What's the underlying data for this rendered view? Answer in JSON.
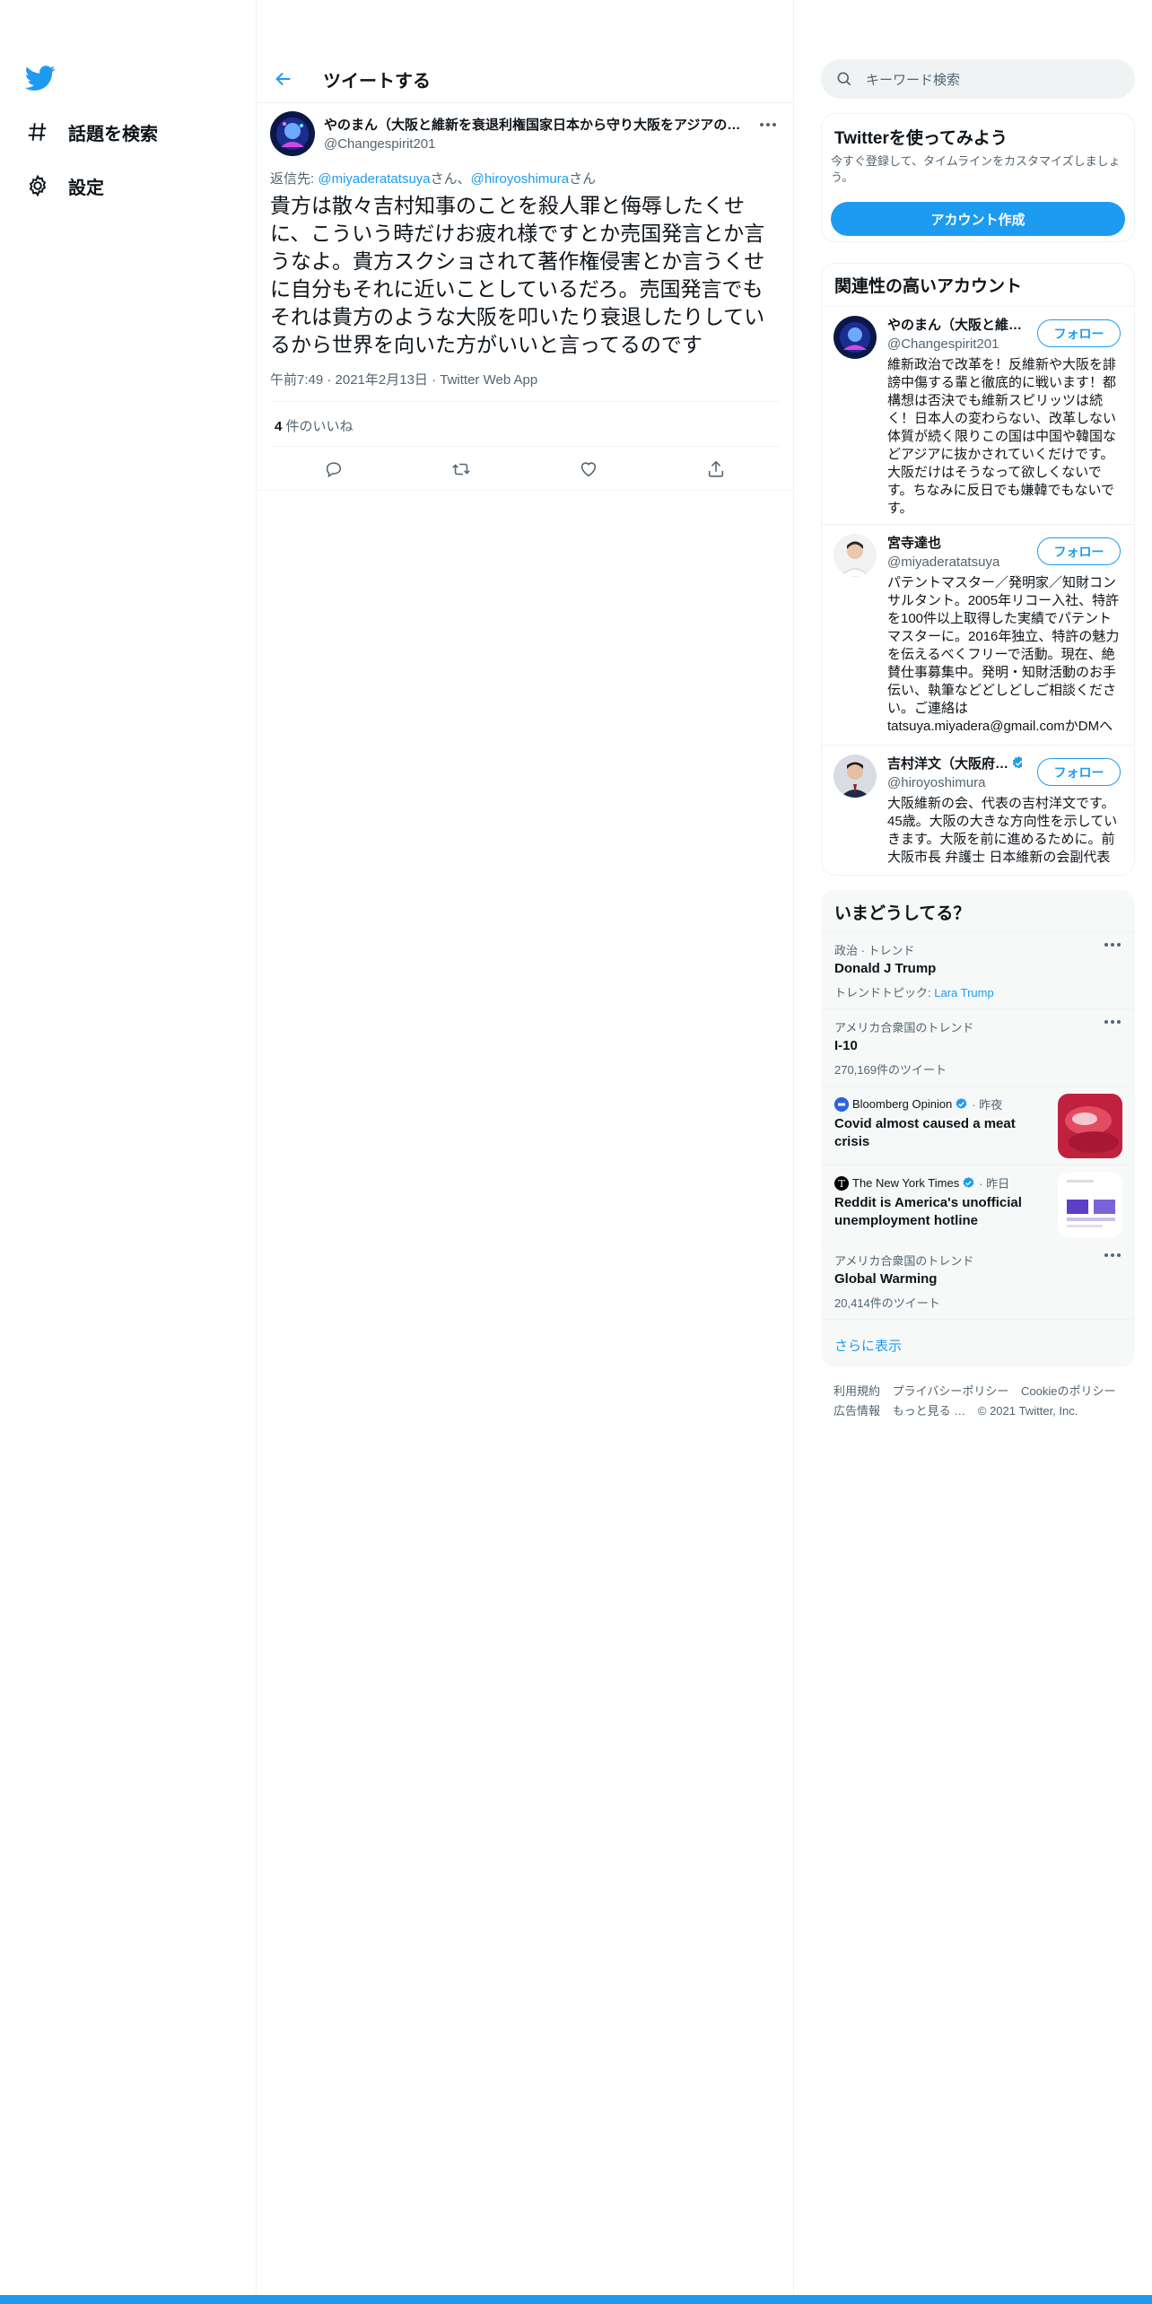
{
  "nav": {
    "logo_icon": "twitter-bird-icon",
    "items": [
      {
        "icon": "hashtag-icon",
        "label": "話題を検索"
      },
      {
        "icon": "gear-icon",
        "label": "設定"
      }
    ]
  },
  "header": {
    "back_icon": "arrow-left-icon",
    "title": "ツイートする"
  },
  "tweet": {
    "author_name": "やのまん（大阪と維新を衰退利権国家日本から守り大阪をアジアの…",
    "author_handle": "@Changespirit201",
    "reply_prefix": "返信先: ",
    "reply_user1": "@miyaderatatsuya",
    "reply_sep1": "さん、",
    "reply_user2": "@hiroyoshimura",
    "reply_sep2": "さん",
    "text": "貴方は散々吉村知事のことを殺人罪と侮辱したくせに、こういう時だけお疲れ様ですとか売国発言とか言うなよ。貴方スクショされて著作権侵害とか言うくせに自分もそれに近いことしているだろ。売国発言でもそれは貴方のような大阪を叩いたり衰退したりしているから世界を向いた方がいいと言ってるのです",
    "meta": "午前7:49 · 2021年2月13日 · Twitter Web App",
    "likes_count": "4",
    "likes_label": " 件のいいね",
    "actions": [
      "reply-icon",
      "retweet-icon",
      "like-icon",
      "share-icon"
    ]
  },
  "search": {
    "placeholder": "キーワード検索"
  },
  "signup": {
    "title": "Twitterを使ってみよう",
    "subtitle": "今すぐ登録して、タイムラインをカスタマイズしましょう。",
    "button": "アカウント作成"
  },
  "related": {
    "title": "関連性の高いアカウント",
    "follow_label": "フォロー",
    "accounts": [
      {
        "name": "やのまん（大阪と維…",
        "handle": "@Changespirit201",
        "bio": "維新政治で改革を！反維新や大阪を誹謗中傷する輩と徹底的に戦います！都構想は否決でも維新スピリッツは続く！日本人の変わらない、改革しない体質が続く限りこの国は中国や韓国などアジアに抜かされていくだけです。大阪だけはそうなって欲しくないです。ちなみに反日でも嫌韓でもないです。"
      },
      {
        "name": "宮寺達也",
        "handle": "@miyaderatatsuya",
        "bio": "パテントマスター／発明家／知財コンサルタント。2005年リコー入社、特許を100件以上取得した実績でパテントマスターに。2016年独立、特許の魅力を伝えるべくフリーで活動。現在、絶賛仕事募集中。発明・知財活動のお手伝い、執筆などどしどしご相談ください。ご連絡はtatsuya.miyadera@gmail.comかDMへ"
      },
      {
        "name": "吉村洋文（大阪府…",
        "handle": "@hiroyoshimura",
        "bio": "大阪維新の会、代表の吉村洋文です。45歳。大阪の大きな方向性を示していきます。大阪を前に進めるために。前大阪市長 弁護士 日本維新の会副代表"
      }
    ]
  },
  "trends": {
    "title": "いまどうしてる？",
    "items": [
      {
        "context": "政治 · トレンド",
        "topic": "Donald J Trump",
        "extra_prefix": "トレンドトピック: ",
        "extra_link": "Lara Trump"
      },
      {
        "context": "アメリカ合衆国のトレンド",
        "topic": "I-10",
        "count": "270,169件のツイート"
      },
      {
        "source": "Bloomberg Opinion",
        "time": "· 昨夜",
        "headline": "Covid almost caused a meat crisis"
      },
      {
        "source": "The New York Times",
        "time": "· 昨日",
        "headline": "Reddit is America's unofficial unemployment hotline"
      },
      {
        "context": "アメリカ合衆国のトレンド",
        "topic": "Global Warming",
        "count": "20,414件のツイート"
      }
    ],
    "show_more": "さらに表示"
  },
  "footer": {
    "links": [
      "利用規約",
      "プライバシーポリシー",
      "Cookieのポリシー",
      "広告情報",
      "もっと見る …",
      "© 2021 Twitter, Inc."
    ]
  },
  "colors": {
    "accent": "#1d9bf0",
    "text_primary": "#0f1419",
    "text_secondary": "#536471",
    "border": "#eff3f4"
  }
}
